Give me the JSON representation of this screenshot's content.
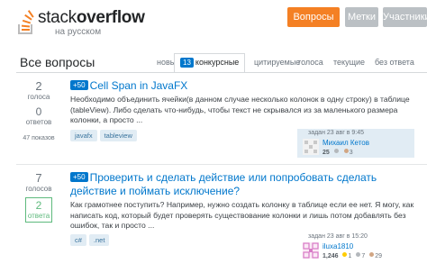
{
  "logo": {
    "main_light": "stack",
    "main_bold": "overflow",
    "sub": "на русском"
  },
  "nav": {
    "questions": "Вопросы",
    "tags": "Метки",
    "users": "Участники"
  },
  "page_title": "Все вопросы",
  "tabs": [
    {
      "label": "новые"
    },
    {
      "count": "13",
      "label": "конкурсные",
      "active": true
    },
    {
      "label": "цитируемые"
    },
    {
      "label": "голоса"
    },
    {
      "label": "текущие"
    },
    {
      "label": "без ответа"
    }
  ],
  "questions": [
    {
      "votes": "2",
      "votes_label": "голоса",
      "answers": "0",
      "answers_label": "ответов",
      "views": "47 показов",
      "bounty": "+50",
      "title": "Cell Span in JavaFX",
      "excerpt": "Необходимо объединить ячейки(в данном случае несколько колонок в одну строку) в таблице (tableView). Либо сделать что-нибудь, чтобы текст не скрывался из за маленького размера колонки, а просто ...",
      "tags": [
        "javafx",
        "tableview"
      ],
      "asked": "задан 23 авг в 9:45",
      "user": "Михаил Кетов",
      "rep": "25",
      "badges": {
        "silver": "",
        "bronze": "3"
      }
    },
    {
      "votes": "7",
      "votes_label": "голосов",
      "answers": "2",
      "answers_label": "ответа",
      "views": "",
      "bounty": "+50",
      "title": "Проверить и сделать действие или попробовать сделать действие и поймать исключение?",
      "excerpt": "Как грамотнее поступить? Например, нужно создать колонку в таблице если ее нет. Я могу, как написать код, который будет проверять существование колонки и лишь потом добавлять без ошибок, так и просто ...",
      "tags": [
        "c#",
        ".net"
      ],
      "asked": "задан 23 авг в 15:20",
      "user": "iluxa1810",
      "rep": "1,246",
      "badges": {
        "gold": "1",
        "silver": "7",
        "bronze": "29"
      }
    }
  ],
  "colors": {
    "accent": "#f48024",
    "link": "#0077cc",
    "answered": "#5eba7d",
    "tag_bg": "#e1ecf4"
  }
}
